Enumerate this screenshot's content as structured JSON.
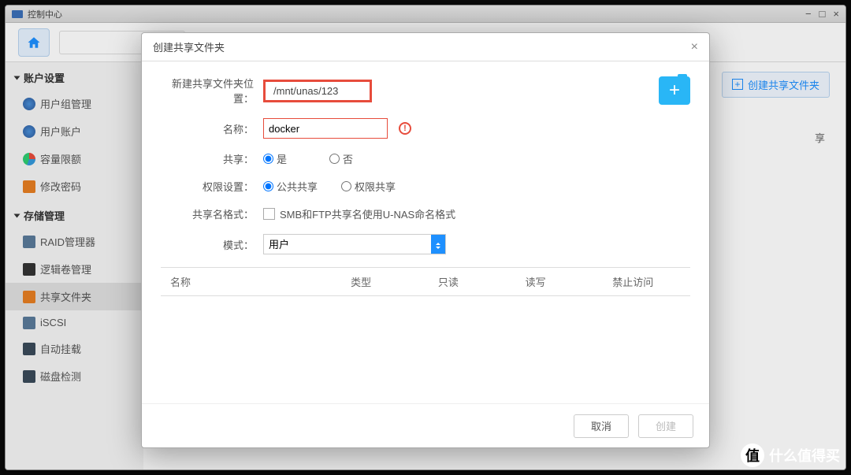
{
  "window": {
    "title": "控制中心"
  },
  "sidebar": {
    "section1": "账户设置",
    "items1": [
      {
        "label": "用户组管理"
      },
      {
        "label": "用户账户"
      },
      {
        "label": "容量限额"
      },
      {
        "label": "修改密码"
      }
    ],
    "section2": "存储管理",
    "items2": [
      {
        "label": "RAID管理器"
      },
      {
        "label": "逻辑卷管理"
      },
      {
        "label": "共享文件夹"
      },
      {
        "label": "iSCSI"
      },
      {
        "label": "自动挂载"
      },
      {
        "label": "磁盘检测"
      }
    ]
  },
  "main": {
    "create_btn": "创建共享文件夹",
    "hint_fragment": "享"
  },
  "modal": {
    "title": "创建共享文件夹",
    "path_label": "新建共享文件夹位置：",
    "path_value": "/mnt/unas/123",
    "name_label": "名称：",
    "name_value": "docker",
    "share_label": "共享：",
    "share_yes": "是",
    "share_no": "否",
    "perm_label": "权限设置：",
    "perm_public": "公共共享",
    "perm_private": "权限共享",
    "naming_label": "共享名格式：",
    "naming_check": "SMB和FTP共享名使用U-NAS命名格式",
    "mode_label": "模式：",
    "mode_value": "用户",
    "table": {
      "col_name": "名称",
      "col_type": "类型",
      "col_ro": "只读",
      "col_rw": "读写",
      "col_deny": "禁止访问"
    },
    "cancel": "取消",
    "create": "创建"
  },
  "watermark": "什么值得买"
}
